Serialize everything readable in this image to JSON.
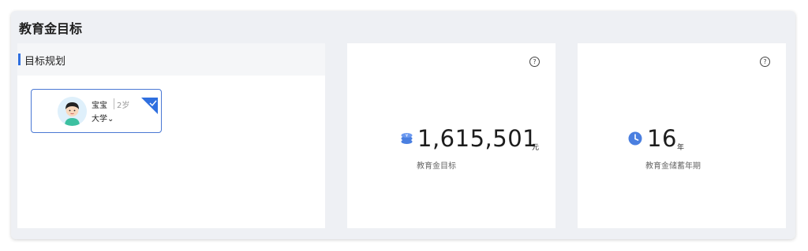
{
  "panel": {
    "title": "教育金目标"
  },
  "plan": {
    "title": "目标规划",
    "child": {
      "name": "宝宝",
      "age": "2岁",
      "goal": "大学"
    }
  },
  "amount": {
    "value": "1,615,501",
    "unit": "元",
    "label": "教育金目标",
    "help": "?"
  },
  "years": {
    "value": "16",
    "unit": "年",
    "label": "教育金储蓄年期",
    "help": "?"
  },
  "colors": {
    "accent": "#2f6fdf",
    "icon": "#4a7fe0"
  }
}
